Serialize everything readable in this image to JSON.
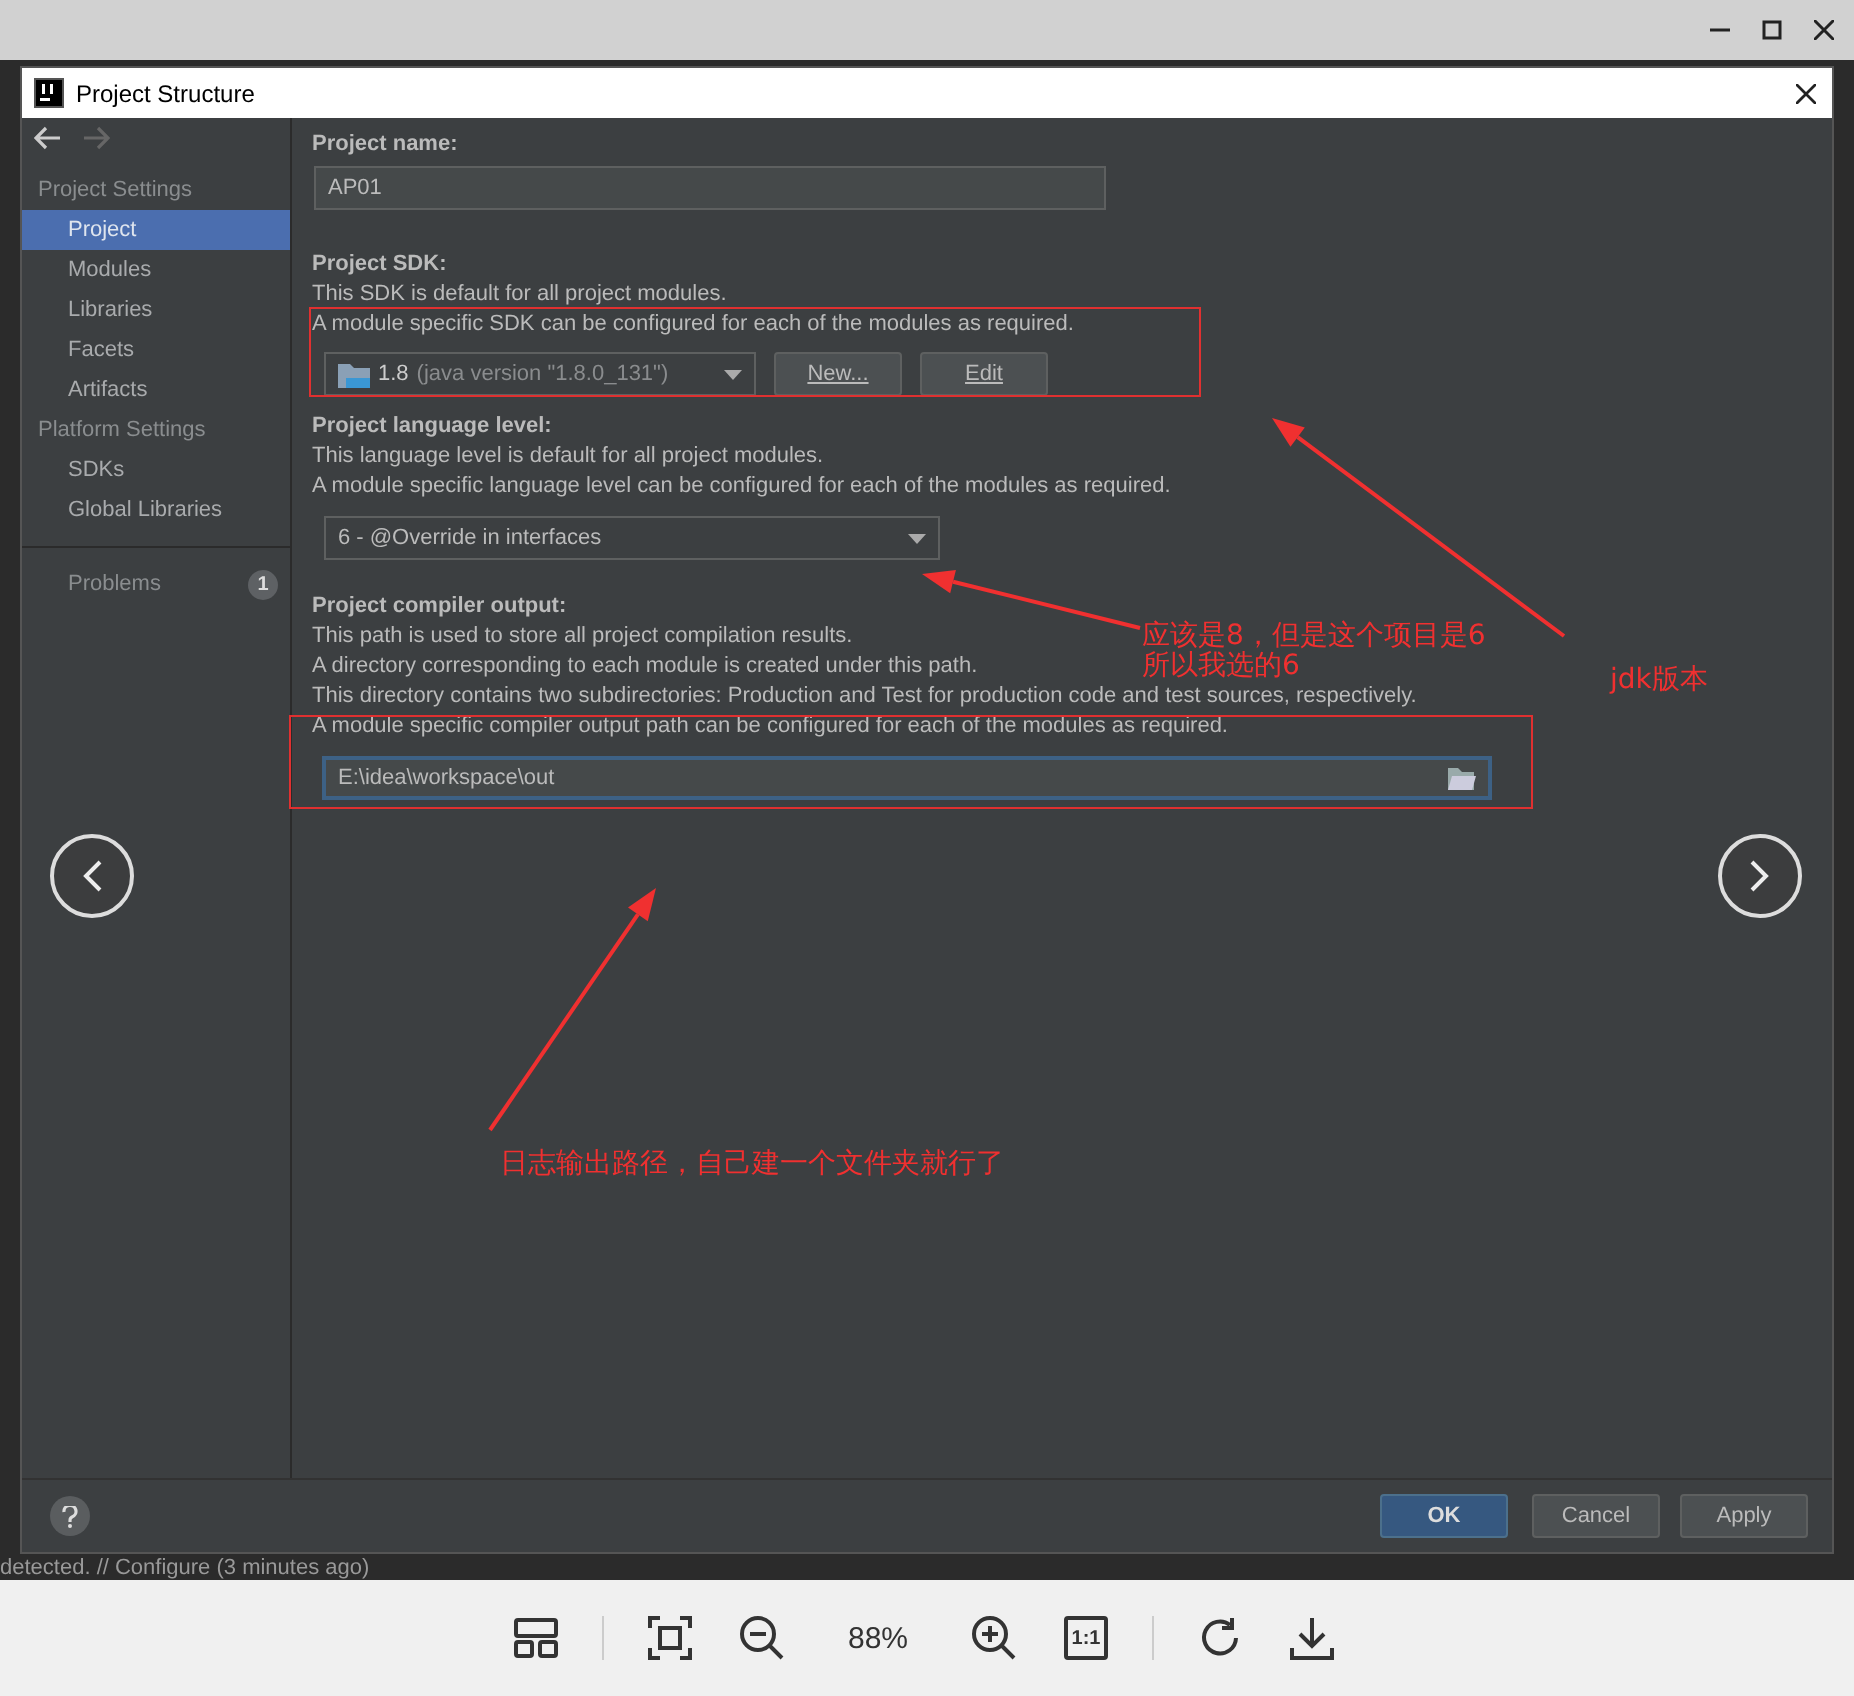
{
  "dialog": {
    "title": "Project Structure"
  },
  "sidebar": {
    "sections": [
      {
        "heading": "Project Settings",
        "items": [
          {
            "label": "Project",
            "selected": true
          },
          {
            "label": "Modules",
            "selected": false
          },
          {
            "label": "Libraries",
            "selected": false
          },
          {
            "label": "Facets",
            "selected": false
          },
          {
            "label": "Artifacts",
            "selected": false
          }
        ]
      },
      {
        "heading": "Platform Settings",
        "items": [
          {
            "label": "SDKs",
            "selected": false
          },
          {
            "label": "Global Libraries",
            "selected": false
          }
        ]
      }
    ],
    "problems": {
      "label": "Problems",
      "count": "1"
    }
  },
  "form": {
    "project_name": {
      "label": "Project name:",
      "value": "AP01"
    },
    "sdk": {
      "label": "Project SDK:",
      "description": [
        "This SDK is default for all project modules.",
        "A module specific SDK can be configured for each of the modules as required."
      ],
      "version": "1.8",
      "detail": "(java version \"1.8.0_131\")",
      "buttons": [
        "New...",
        "Edit"
      ]
    },
    "language_level": {
      "label": "Project language level:",
      "description": [
        "This language level is default for all project modules.",
        "A module specific language level can be configured for each of the modules as required."
      ],
      "value": "6 - @Override in interfaces"
    },
    "compiler_output": {
      "label": "Project compiler output:",
      "description": [
        "This path is used to store all project compilation results.",
        "A directory corresponding to each module is created under this path.",
        "This directory contains two subdirectories: Production and Test for production code and test sources, respectively.",
        "A module specific compiler output path can be configured for each of the modules as required."
      ],
      "value": "E:\\idea\\workspace\\out"
    }
  },
  "buttons": [
    {
      "label": "OK",
      "primary": true
    },
    {
      "label": "Cancel",
      "primary": false
    },
    {
      "label": "Apply",
      "primary": false
    }
  ],
  "background_status": "detected. // Configure (3 minutes ago)",
  "viewer_toolbar": {
    "zoom": "88%",
    "actual_size": "1:1"
  },
  "annotations": [
    {
      "lines": [
        "应该是8，但是这个项目是6",
        "所以我选的6"
      ]
    },
    {
      "lines": [
        "jdk版本"
      ]
    },
    {
      "lines": [
        "日志输出路径，自己建一个文件夹就行了"
      ]
    }
  ]
}
